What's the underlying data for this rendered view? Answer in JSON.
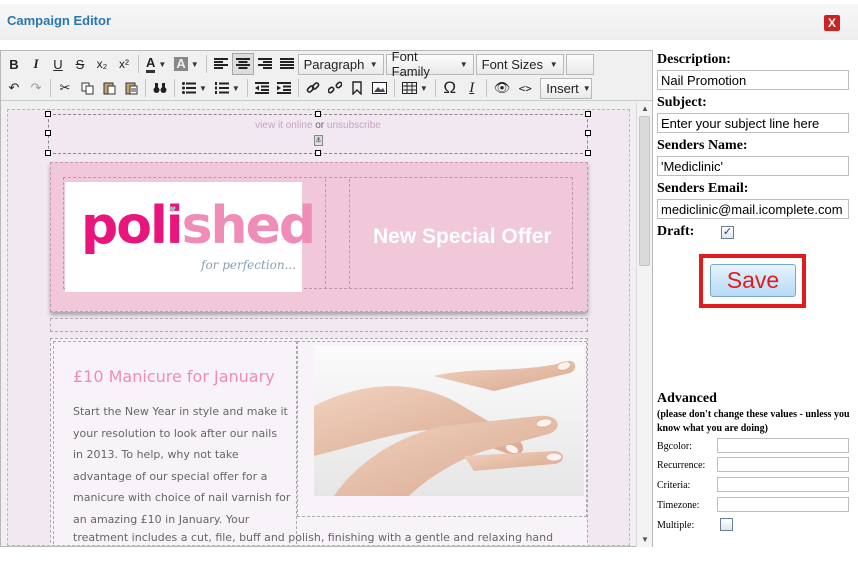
{
  "window": {
    "title": "Campaign Editor",
    "close_label": "X"
  },
  "toolbar": {
    "row1": {
      "bold": "B",
      "italic": "I",
      "underline": "U",
      "strike": "S",
      "subscript": "x₂",
      "superscript": "x²",
      "font_color": "A",
      "highlight": "A",
      "format": "Paragraph",
      "font_family": "Font Family",
      "font_sizes": "Font Sizes"
    },
    "row2": {
      "omega": "Ω",
      "clear_format": "I",
      "insert": "Insert"
    }
  },
  "email": {
    "view_online": "view it online",
    "or": "or",
    "unsubscribe": "unsubscribe",
    "logo_primary": "poli",
    "logo_secondary": "shed",
    "logo_tagline": "for perfection...",
    "offer": "New Special Offer",
    "article_title": "£10 Manicure for January",
    "body_lines": [
      "Start the New Year in style and make it",
      "your resolution to look after our nails",
      "in 2013. To help, why not take",
      "advantage of our special offer for a",
      "manicure with choice of nail varnish for",
      "an amazing £10 in January. Your"
    ],
    "body_long_line": "treatment includes a cut, file, buff and polish, finishing with a gentle and relaxing hand"
  },
  "form": {
    "description_label": "Description:",
    "description_value": "Nail Promotion",
    "subject_label": "Subject:",
    "subject_value": "Enter your subject line here",
    "senders_name_label": "Senders Name:",
    "senders_name_value": "'Mediclinic'",
    "senders_email_label": "Senders Email:",
    "senders_email_value": "mediclinic@mail.icomplete.com",
    "draft_label": "Draft:",
    "draft_checked": true,
    "save_label": "Save"
  },
  "advanced": {
    "title": "Advanced",
    "note": "(please don't change these values - unless you know what you are doing)",
    "bgcolor_label": "Bgcolor:",
    "recurrence_label": "Recurrence:",
    "criteria_label": "Criteria:",
    "timezone_label": "Timezone:",
    "multiple_label": "Multiple:",
    "multiple_checked": false
  },
  "colors": {
    "title": "#2a76b4",
    "banner": "#f0c8d9",
    "pink": "#e8157d",
    "light_pink": "#f08cb8",
    "save_text": "#e21c1c",
    "save_frame": "#e21c1c"
  }
}
